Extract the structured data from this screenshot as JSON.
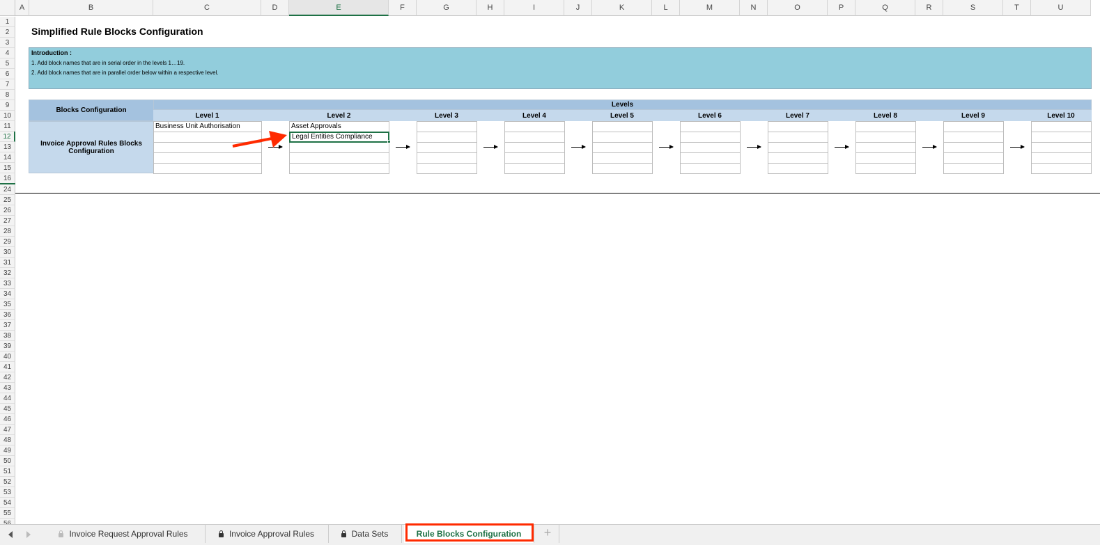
{
  "columns": [
    "A",
    "B",
    "C",
    "D",
    "E",
    "F",
    "G",
    "H",
    "I",
    "J",
    "K",
    "L",
    "M",
    "N",
    "O",
    "P",
    "Q",
    "R",
    "S",
    "T",
    "U"
  ],
  "selected_column": "E",
  "rows": [
    "1",
    "2",
    "3",
    "4",
    "5",
    "6",
    "7",
    "8",
    "9",
    "10",
    "11",
    "12",
    "13",
    "14",
    "15",
    "16",
    "24",
    "25",
    "26",
    "27",
    "28",
    "29",
    "30",
    "31",
    "32",
    "33",
    "34",
    "35",
    "36",
    "37",
    "38",
    "39",
    "40",
    "41",
    "42",
    "43",
    "44",
    "45",
    "46",
    "47",
    "48",
    "49",
    "50",
    "51",
    "52",
    "53",
    "54",
    "55",
    "56"
  ],
  "selected_row": "12",
  "sheet": {
    "title": "Simplified Rule Blocks Configuration",
    "intro": {
      "heading": "Introduction :",
      "lines": [
        "1. Add block names that are in serial order in the levels 1…19.",
        "2. Add block names that are in parallel order below within a respective level."
      ]
    },
    "table": {
      "corner_label": "Blocks Configuration",
      "levels_label": "Levels",
      "row_label": "Invoice Approval Rules Blocks Configuration",
      "levels": [
        {
          "label": "Level 1",
          "blocks": [
            "Business Unit Authorisation",
            "",
            "",
            "",
            ""
          ]
        },
        {
          "label": "Level 2",
          "blocks": [
            "Asset Approvals",
            "Legal Entities Compliance",
            "",
            "",
            ""
          ]
        },
        {
          "label": "Level 3",
          "blocks": [
            "",
            "",
            "",
            "",
            ""
          ]
        },
        {
          "label": "Level 4",
          "blocks": [
            "",
            "",
            "",
            "",
            ""
          ]
        },
        {
          "label": "Level 5",
          "blocks": [
            "",
            "",
            "",
            "",
            ""
          ]
        },
        {
          "label": "Level 6",
          "blocks": [
            "",
            "",
            "",
            "",
            ""
          ]
        },
        {
          "label": "Level 7",
          "blocks": [
            "",
            "",
            "",
            "",
            ""
          ]
        },
        {
          "label": "Level 8",
          "blocks": [
            "",
            "",
            "",
            "",
            ""
          ]
        },
        {
          "label": "Level 9",
          "blocks": [
            "",
            "",
            "",
            "",
            ""
          ]
        },
        {
          "label": "Level 10",
          "blocks": [
            "",
            "",
            "",
            "",
            ""
          ]
        }
      ]
    },
    "selected_cell": "E12"
  },
  "tabs": [
    {
      "label": "Invoice Request Approval Rules",
      "icon": "lock-icon",
      "active": false
    },
    {
      "label": "Invoice Approval Rules",
      "icon": "lock-icon",
      "active": false
    },
    {
      "label": "Data Sets",
      "icon": "lock-icon",
      "active": false
    },
    {
      "label": "Rule Blocks Configuration",
      "icon": "",
      "active": true
    }
  ],
  "colors": {
    "accent": "#1e7145",
    "intro_bg": "#92cddc",
    "header_dark": "#a4c2df",
    "header_light": "#c5d9ec",
    "annotation": "#ff2a00"
  }
}
